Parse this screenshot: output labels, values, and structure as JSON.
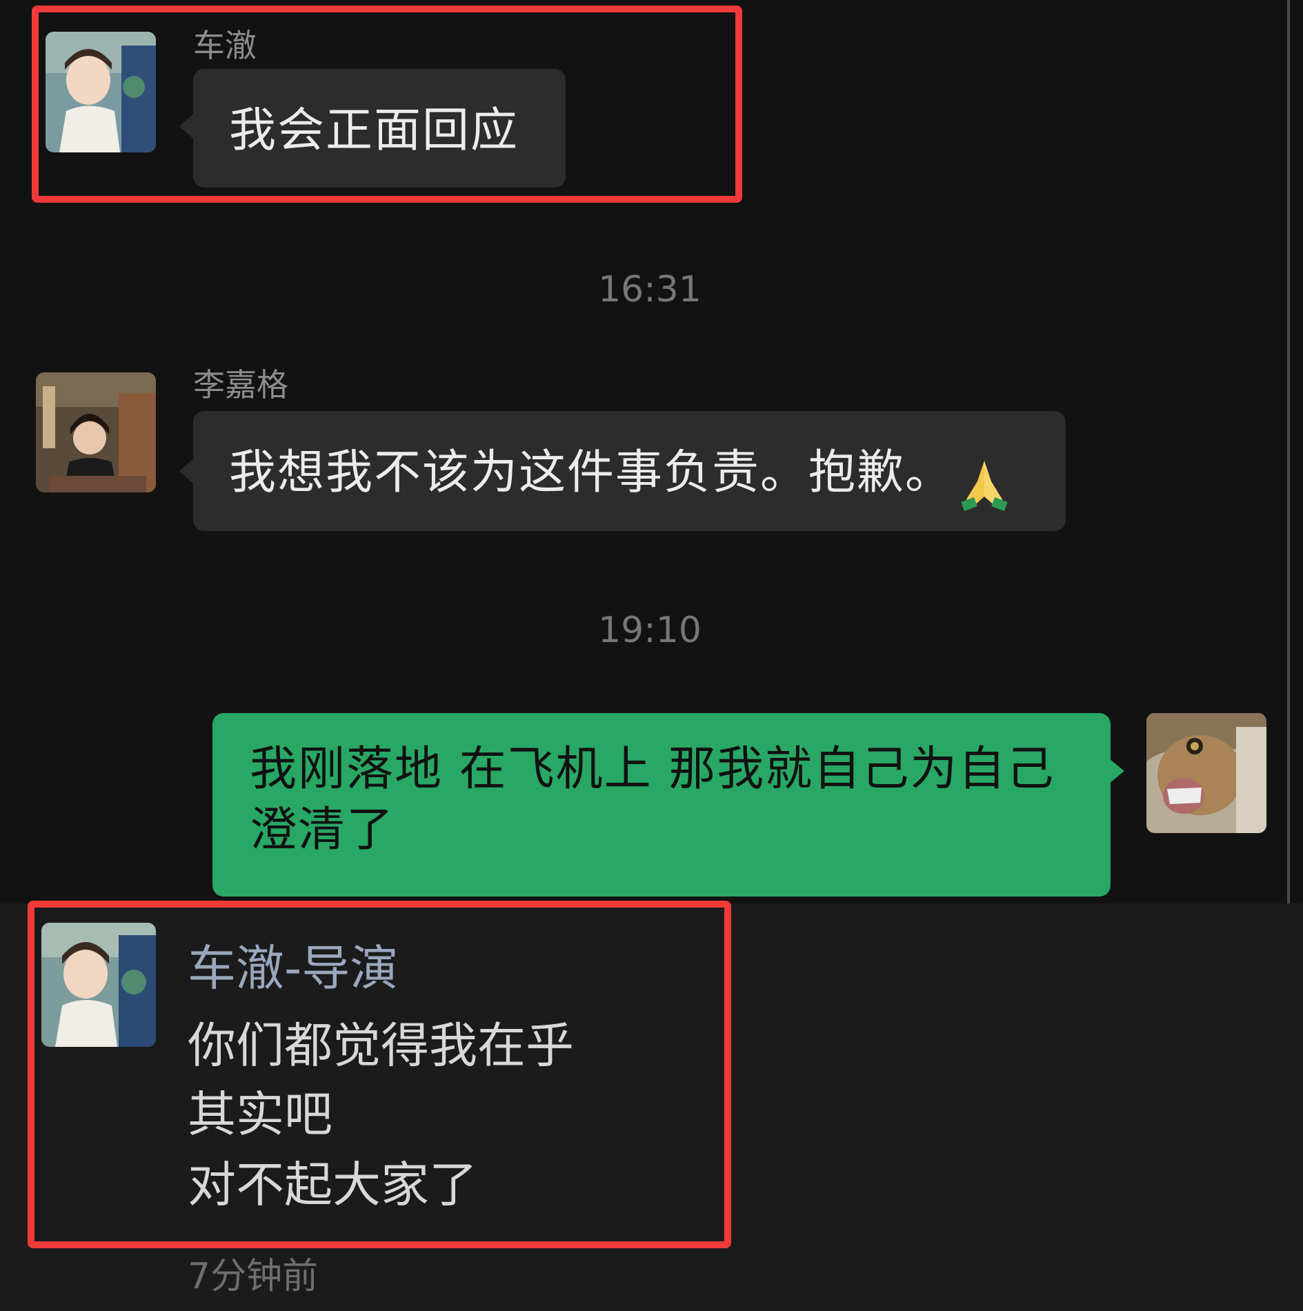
{
  "chat": {
    "msg1": {
      "sender": "车澈",
      "text": "我会正面回应",
      "avatar_icon": "child-photo-avatar"
    },
    "timestamp1": "16:31",
    "msg2": {
      "sender": "李嘉格",
      "text": "我想我不该为这件事负责。抱歉。",
      "emoji": "folded-hands-emoji",
      "avatar_icon": "woman-photo-avatar"
    },
    "timestamp2": "19:10",
    "msg3": {
      "line1": "我刚落地 在飞机上 那我就自己为自己",
      "line2": "澄清了",
      "avatar_icon": "lion-photo-avatar"
    }
  },
  "reply": {
    "sender": "车澈-导演",
    "lines": [
      "你们都觉得我在乎",
      "其实吧",
      "对不起大家了"
    ],
    "relative_time": "7分钟前",
    "avatar_icon": "child-photo-avatar"
  },
  "colors": {
    "highlight": "#f03a3a",
    "bubble_green": "#29a765",
    "bubble_dark": "#2c2c2c"
  }
}
